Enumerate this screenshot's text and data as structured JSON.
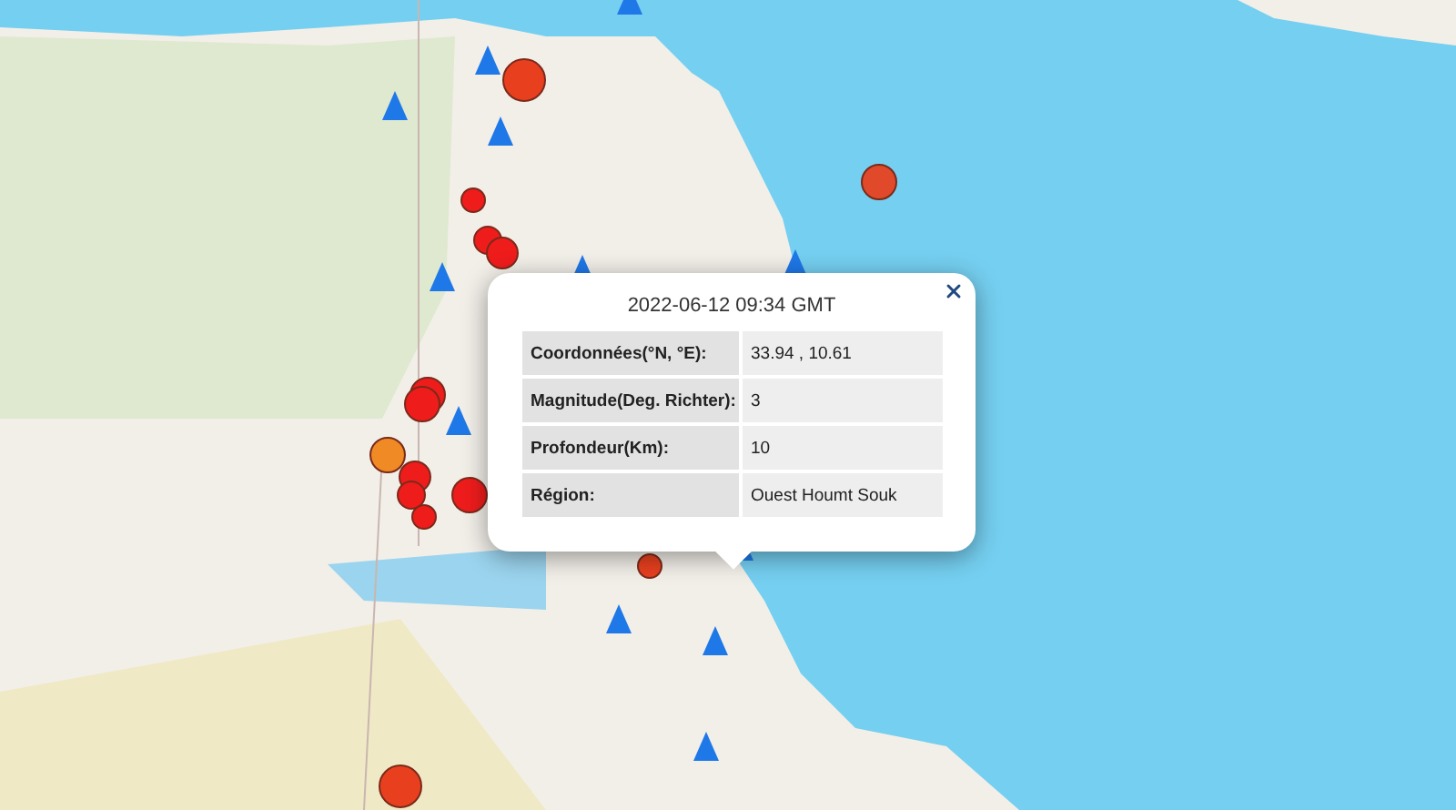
{
  "map": {
    "markers": [
      {
        "kind": "earthquake",
        "color": "#e8401f"
      },
      {
        "kind": "earthquake",
        "color": "#e04a2a"
      },
      {
        "kind": "earthquake",
        "color": "#ef1c1c"
      },
      {
        "kind": "earthquake",
        "color": "#ef1c1c"
      },
      {
        "kind": "earthquake",
        "color": "#ef1c1c"
      },
      {
        "kind": "earthquake",
        "color": "#ef1c1c"
      },
      {
        "kind": "earthquake",
        "color": "#ef1c1c"
      },
      {
        "kind": "earthquake",
        "color": "#f08a24"
      },
      {
        "kind": "earthquake",
        "color": "#ef1c1c"
      },
      {
        "kind": "earthquake",
        "color": "#ef1c1c"
      },
      {
        "kind": "earthquake",
        "color": "#ef1c1c"
      },
      {
        "kind": "earthquake",
        "color": "#ef1c1c"
      },
      {
        "kind": "earthquake",
        "color": "#e8401f"
      },
      {
        "kind": "earthquake",
        "color": "#e8401f"
      },
      {
        "kind": "station"
      },
      {
        "kind": "station"
      },
      {
        "kind": "station"
      },
      {
        "kind": "station"
      },
      {
        "kind": "station"
      },
      {
        "kind": "station"
      },
      {
        "kind": "station"
      },
      {
        "kind": "station"
      },
      {
        "kind": "station"
      },
      {
        "kind": "station"
      },
      {
        "kind": "station"
      },
      {
        "kind": "station"
      }
    ]
  },
  "popup": {
    "title": "2022-06-12 09:34 GMT",
    "rows": [
      {
        "label": "Coordonnées(°N, °E):",
        "value": "33.94 , 10.61"
      },
      {
        "label": "Magnitude(Deg. Richter):",
        "value": "3"
      },
      {
        "label": "Profondeur(Km):",
        "value": "10"
      },
      {
        "label": "Région:",
        "value": "Ouest Houmt Souk"
      }
    ]
  }
}
